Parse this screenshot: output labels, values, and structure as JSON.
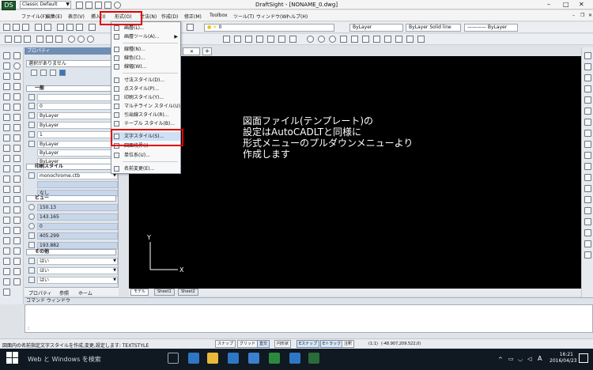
{
  "window": {
    "title": "DraftSight - [NONAME_0.dwg]",
    "workspace": "Classic Default",
    "app_icon_text": "DS"
  },
  "menu": {
    "items": [
      "ファイル(F)",
      "編集(E)",
      "表示(V)",
      "挿入(I)",
      "形式(O)",
      "寸法(N)",
      "作成(D)",
      "修正(M)",
      "Toolbox",
      "ツール(T)",
      "ウィンドウ(W)",
      "ヘルプ(H)"
    ]
  },
  "toolbar": {
    "layer_value": "0",
    "color_value": "ByLayer",
    "linetype_value": "ByLayer",
    "lineweight_value": "Solid line",
    "style_value": "———— ByLayer"
  },
  "format_menu": {
    "items": [
      {
        "label": "画層(L)...",
        "icon": "layer-icon"
      },
      {
        "label": "画層ツール(A)...",
        "icon": "layer-tools-icon"
      },
      {
        "label": "線種(N)...",
        "icon": "linetype-icon"
      },
      {
        "label": "線色(C)...",
        "icon": "color-icon"
      },
      {
        "label": "線幅(W)...",
        "icon": "lineweight-icon"
      },
      {
        "label": "寸法スタイル(D)...",
        "icon": "dim-style-icon"
      },
      {
        "label": "点スタイル(P)...",
        "icon": "point-style-icon"
      },
      {
        "label": "印刷スタイル(Y)...",
        "icon": "print-style-icon"
      },
      {
        "label": "マルチライン スタイル(U)...",
        "icon": "mline-style-icon"
      },
      {
        "label": "引出線スタイル(R)...",
        "icon": "leader-style-icon"
      },
      {
        "label": "テーブル スタイル(B)...",
        "icon": "table-style-icon"
      },
      {
        "label": "文字スタイル(S)...",
        "icon": "text-style-icon"
      },
      {
        "label": "図面境界(I)",
        "icon": "boundary-icon"
      },
      {
        "label": "単位系(U)...",
        "icon": "units-icon"
      },
      {
        "label": "名前変更(E)...",
        "icon": "rename-icon"
      }
    ]
  },
  "properties": {
    "title": "プロパティ",
    "selection": "選択がありません",
    "general_label": "一般",
    "general_rows": [
      "",
      "0",
      "ByLayer",
      "ByLayer",
      "1",
      "ByLayer",
      "ByLayer",
      "ByLayer"
    ],
    "print_label": "印刷スタイル",
    "print_rows": [
      "monochrome.ctb",
      "",
      "なし"
    ],
    "view_label": "ビュー",
    "view_rows": [
      "150.13",
      "143.165",
      "0",
      "405.299",
      "193.882"
    ],
    "other_label": "その他",
    "other_rows": [
      "はい",
      "はい",
      "はい"
    ],
    "tabs": [
      "プロパティ",
      "参照",
      "ホーム"
    ]
  },
  "canvas": {
    "document_tab": "NONAME_0",
    "annotation": [
      "図面ファイル(テンプレート)の",
      "設定はAutoCADLTと同様に",
      "形式メニューのプルダウンメニューより",
      "作成します"
    ],
    "tabs": [
      "モデル",
      "Sheet1",
      "Sheet2"
    ],
    "axis_x": "X",
    "axis_y": "Y"
  },
  "command": {
    "title": "コマンド ウィンドウ",
    "prompt": ":"
  },
  "status": {
    "message": "図面内の名前指定文字スタイルを作成,変更,設定します: TEXTSTYLE",
    "buttons": [
      "スナップ",
      "グリッド",
      "直交",
      "円形状",
      "Eスナップ",
      "Eトラック",
      "注釈",
      "(1:1)"
    ],
    "coords": "(-48.907,209.522,0)"
  },
  "taskbar": {
    "search": "Web と Windows を検索",
    "time": "16:21",
    "date": "2016/04/23",
    "ime": "A"
  }
}
